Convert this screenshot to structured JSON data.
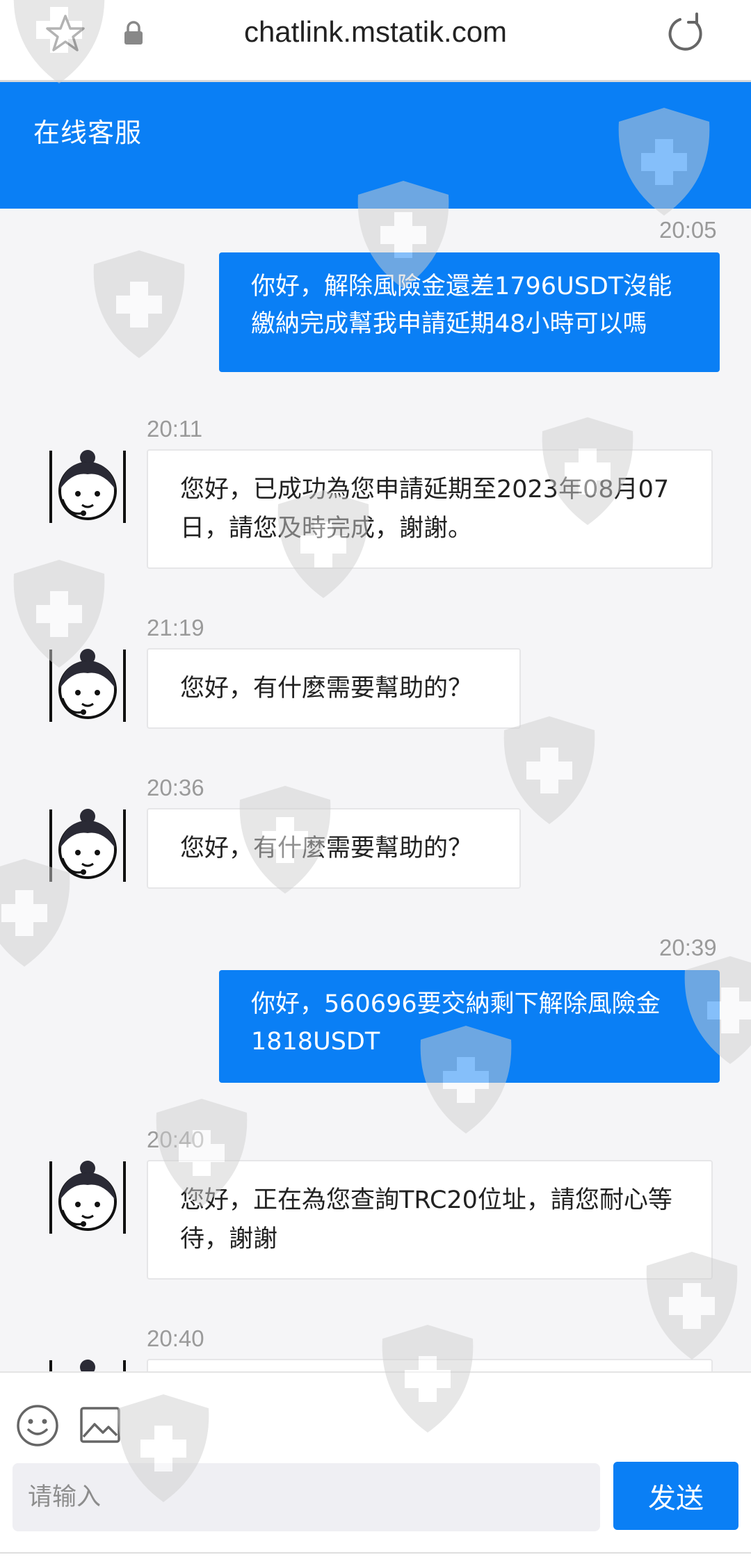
{
  "browser": {
    "url": "chatlink.mstatik.com",
    "icons": {
      "favorite": "star-icon",
      "secure": "lock-icon",
      "reload": "reload-icon"
    }
  },
  "header": {
    "title": "在线客服",
    "background_color": "#0a7ff5"
  },
  "messages": [
    {
      "direction": "outgoing",
      "time": "20:05",
      "text": "你好，解除風險金還差1796USDT沒能繳納完成幫我申請延期48小時可以嗎"
    },
    {
      "direction": "incoming",
      "time": "20:11",
      "text": "您好，已成功為您申請延期至2023年08月07日，請您及時完成，謝謝。"
    },
    {
      "direction": "incoming",
      "time": "21:19",
      "text": "您好，有什麼需要幫助的？"
    },
    {
      "direction": "incoming",
      "time": "20:36",
      "text": "您好，有什麼需要幫助的？"
    },
    {
      "direction": "outgoing",
      "time": "20:39",
      "text": "你好，560696要交納剩下解除風險金1818USDT"
    },
    {
      "direction": "incoming",
      "time": "20:40",
      "text": "您好，正在為您查詢TRC20位址，請您耐心等待，謝謝"
    },
    {
      "direction": "incoming",
      "time": "20:40",
      "text": ""
    }
  ],
  "composer": {
    "placeholder": "请输入",
    "value": "",
    "send_label": "发送",
    "icons": {
      "emoji": "emoji-icon",
      "image": "image-icon"
    }
  },
  "colors": {
    "accent": "#0a7ff5",
    "page_bg": "#f5f5f7",
    "time_text": "#9a9a9a"
  }
}
